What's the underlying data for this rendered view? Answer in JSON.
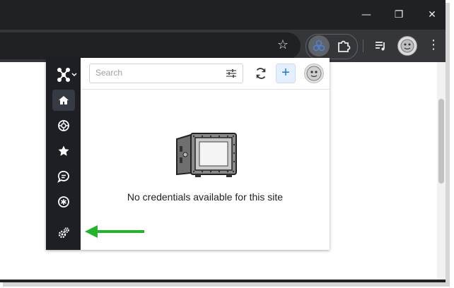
{
  "browser": {
    "window_controls": {
      "minimize_glyph": "—",
      "restore_glyph": "❐",
      "close_glyph": "✕"
    },
    "toolbar": {
      "bookmark_glyph": "☆",
      "menu_glyph": "⋮",
      "active_extension_icon": "password-manager-extension-icon",
      "extensions_icon": "puzzle-icon",
      "media_icon": "media-controls-icon",
      "profile_icon": "profile-avatar"
    }
  },
  "popup": {
    "sidebar": {
      "logo": "app-logo-icon",
      "items": [
        {
          "name": "home",
          "icon": "home-icon",
          "active": true
        },
        {
          "name": "security",
          "icon": "shield-settings-icon",
          "active": false
        },
        {
          "name": "favorites",
          "icon": "star-icon",
          "active": false
        },
        {
          "name": "messages",
          "icon": "chat-icon",
          "active": false
        },
        {
          "name": "password-generator",
          "icon": "asterisk-circle-icon",
          "active": false
        },
        {
          "name": "settings",
          "icon": "gears-icon",
          "active": false
        }
      ]
    },
    "search": {
      "placeholder": "Search"
    },
    "add_glyph": "+",
    "empty_state": {
      "message": "No credentials available for this site"
    }
  },
  "annotation": {
    "color": "#22b52a",
    "points_to": "settings"
  },
  "colors": {
    "browser_frame": "#202124",
    "toolbar": "#35363a",
    "sidebar": "#1d1f24",
    "accent_blue": "#1a73e8",
    "arrow_green": "#22b52a"
  }
}
